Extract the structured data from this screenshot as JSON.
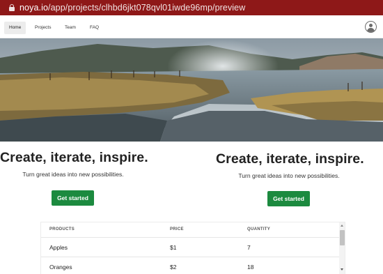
{
  "browser": {
    "url_domain": "noya.io",
    "url_path": "/app/projects/clhbd6jkt078qvl01iwde96mp/preview"
  },
  "nav": {
    "items": [
      {
        "label": "Home",
        "active": true
      },
      {
        "label": "Projects",
        "active": false
      },
      {
        "label": "Team",
        "active": false
      },
      {
        "label": "FAQ",
        "active": false
      }
    ],
    "avatar_icon": "user-circle-icon"
  },
  "hero": {
    "image": "landscape-hot-spring-river"
  },
  "sections": [
    {
      "headline": "Create, iterate, inspire.",
      "subtext": "Turn great ideas into new possibilities.",
      "cta": "Get started"
    },
    {
      "headline": "Create, iterate, inspire.",
      "subtext": "Turn great ideas into new possibilities.",
      "cta": "Get started"
    }
  ],
  "table": {
    "headers": [
      "PRODUCTS",
      "PRICE",
      "QUANTITY"
    ],
    "rows": [
      [
        "Apples",
        "$1",
        "7"
      ],
      [
        "Oranges",
        "$2",
        "18"
      ]
    ]
  },
  "colors": {
    "url_bar": "#8e1818",
    "button": "#1c8a3f",
    "nav_active": "#ececec"
  }
}
